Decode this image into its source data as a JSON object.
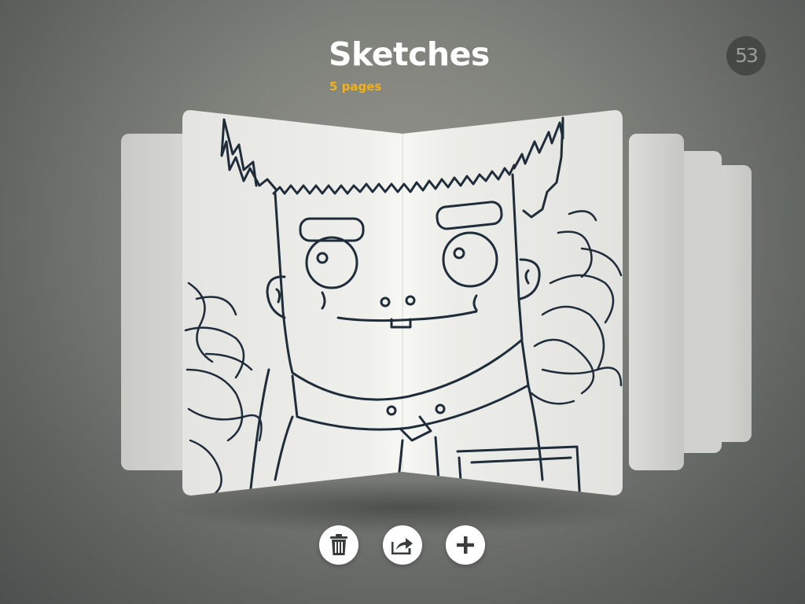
{
  "journal": {
    "title": "Sketches",
    "page_count_label": "5 pages"
  },
  "brand": {
    "logo_text": "53",
    "logo_bg": "#464846"
  },
  "colors": {
    "accent": "#f2b21c",
    "title": "#ffffff",
    "ink": "#1f2d3a",
    "paper": "#eeeeeb"
  },
  "actions": [
    {
      "name": "delete",
      "icon": "trash-icon"
    },
    {
      "name": "share",
      "icon": "share-icon"
    },
    {
      "name": "add",
      "icon": "plus-icon"
    }
  ]
}
